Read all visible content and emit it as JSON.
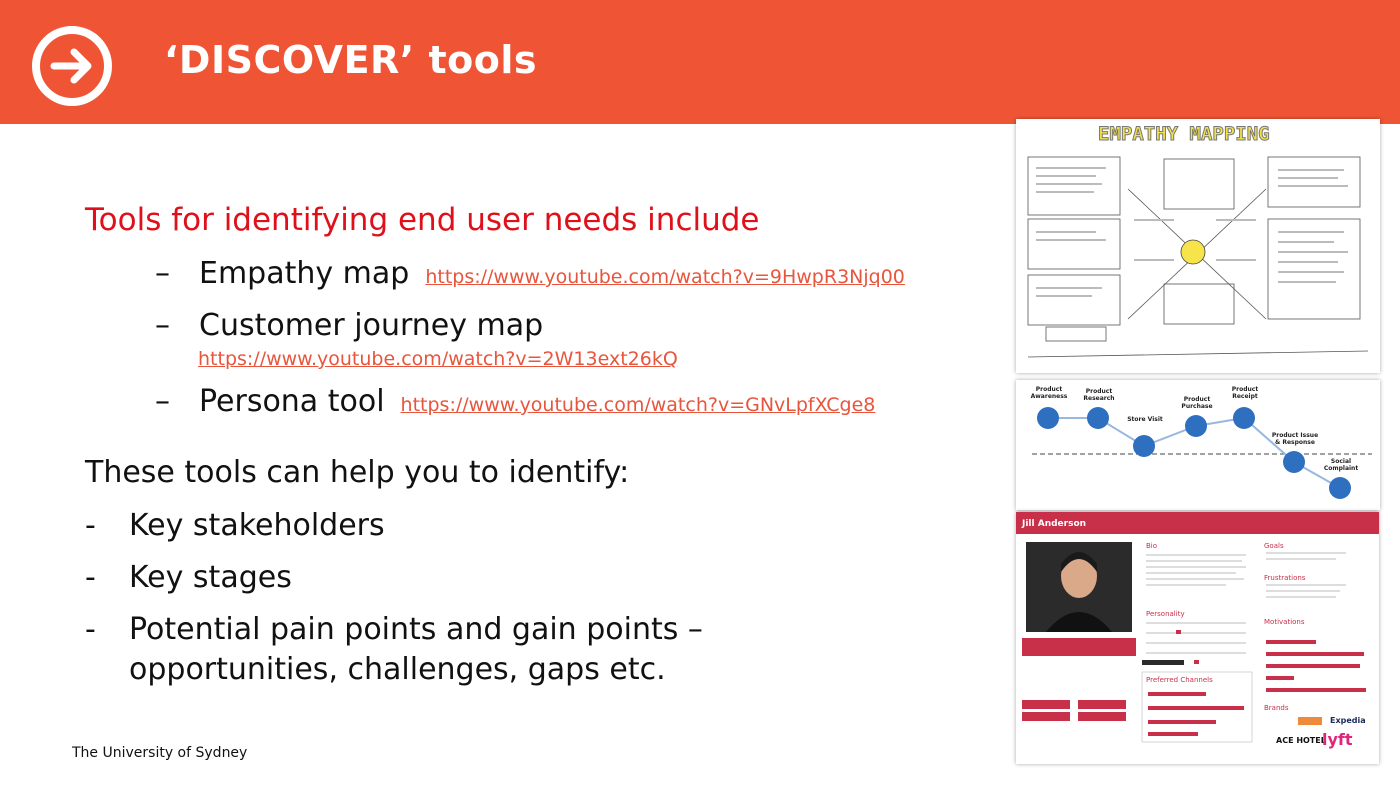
{
  "header": {
    "title": "‘DISCOVER’ tools",
    "icon": "arrow-right-circle-icon",
    "background_color": "#ef5535"
  },
  "content": {
    "intro": "Tools for identifying end user needs include",
    "tools": [
      {
        "dash": "–",
        "name": "Empathy map",
        "link": "https://www.youtube.com/watch?v=9HwpR3Njq00"
      },
      {
        "dash": "–",
        "name": "Customer journey map",
        "link": "https://www.youtube.com/watch?v=2W13ext26kQ"
      },
      {
        "dash": "–",
        "name": "Persona tool",
        "link": "https://www.youtube.com/watch?v=GNvLpfXCge8"
      }
    ],
    "help_heading": "These tools can help you to identify:",
    "bullets": [
      {
        "mark": "-",
        "text": "Key stakeholders"
      },
      {
        "mark": "-",
        "text": "Key stages"
      },
      {
        "mark": "-",
        "text": "Potential pain points and gain points –"
      }
    ],
    "bullet_continuation": "opportunities, challenges, gaps etc."
  },
  "footer": "The University of Sydney",
  "thumbnails": {
    "empathy": {
      "title": "EMPATHY MAPPING"
    },
    "journey": {
      "stages": [
        "Product Awareness",
        "Product Research",
        "Store Visit",
        "Product Purchase",
        "Product Receipt",
        "Product Issue & Response",
        "Social Complaint"
      ]
    },
    "persona": {
      "name": "Jill Anderson",
      "sections": [
        "Bio",
        "Goals",
        "Frustrations",
        "Personality",
        "Motivations",
        "Preferred Channels",
        "Brands"
      ],
      "brands": [
        "Expedia",
        "ACE HOTEL",
        "lyft"
      ]
    }
  },
  "colors": {
    "accent_red": "#e0101a",
    "link": "#e8553d",
    "persona_red": "#c8304a"
  }
}
